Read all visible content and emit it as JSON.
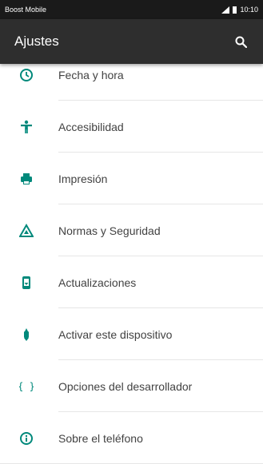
{
  "status_bar": {
    "carrier": "Boost Mobile",
    "time": "10:10"
  },
  "app_bar": {
    "title": "Ajustes",
    "search_icon": "search-icon"
  },
  "colors": {
    "accent": "#00897b",
    "app_bar": "#2e2e2e",
    "status_bar": "#1a1a1a"
  },
  "settings": [
    {
      "label": "Fecha y hora",
      "icon": "clock-icon"
    },
    {
      "label": "Accesibilidad",
      "icon": "accessibility-icon"
    },
    {
      "label": "Impresión",
      "icon": "printer-icon"
    },
    {
      "label": "Normas y Seguridad",
      "icon": "warning-triangle-icon"
    },
    {
      "label": "Actualizaciones",
      "icon": "system-update-icon"
    },
    {
      "label": "Activar este dispositivo",
      "icon": "activate-device-icon"
    },
    {
      "label": "Opciones del desarrollador",
      "icon": "developer-braces-icon"
    },
    {
      "label": "Sobre el teléfono",
      "icon": "info-icon"
    }
  ]
}
